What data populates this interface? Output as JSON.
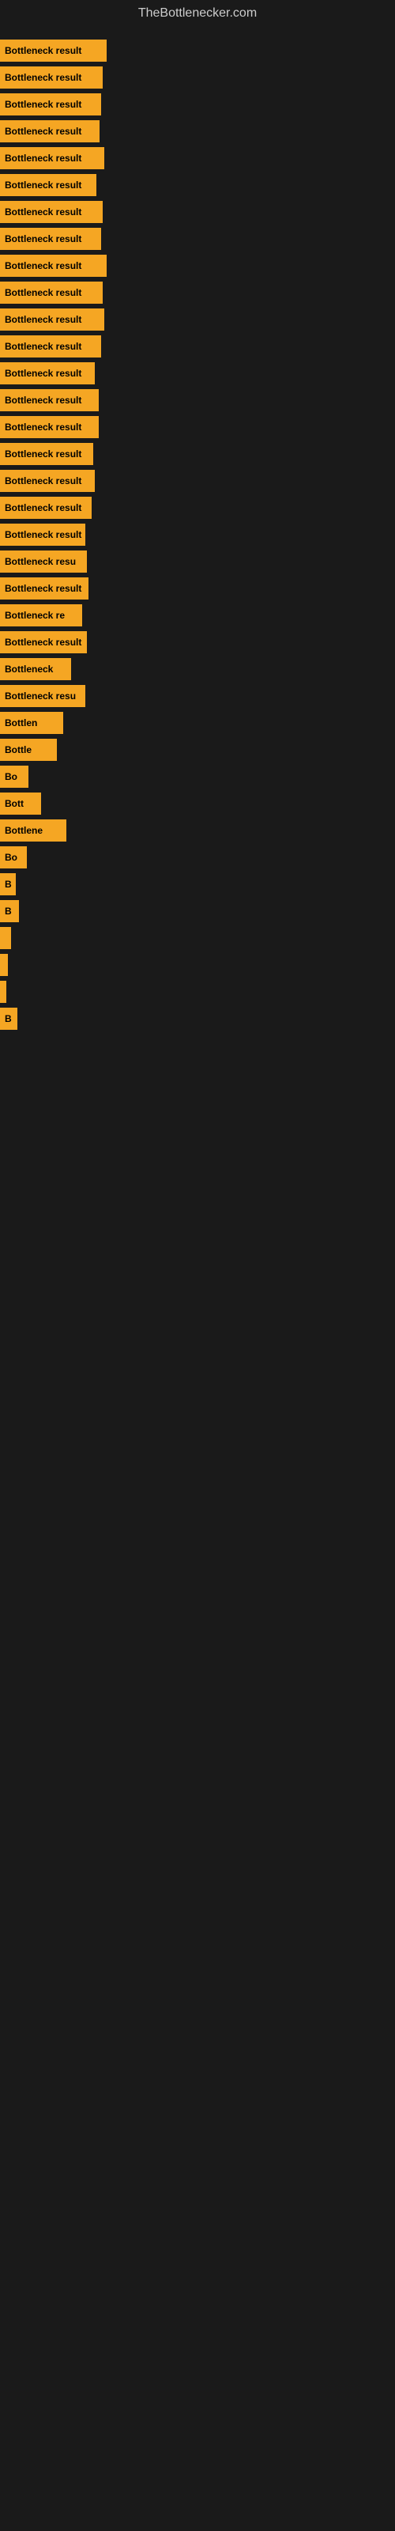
{
  "site": {
    "title": "TheBottlenecker.com"
  },
  "bars": [
    {
      "label": "Bottleneck result",
      "width": 135
    },
    {
      "label": "Bottleneck result",
      "width": 130
    },
    {
      "label": "Bottleneck result",
      "width": 128
    },
    {
      "label": "Bottleneck result",
      "width": 126
    },
    {
      "label": "Bottleneck result",
      "width": 132
    },
    {
      "label": "Bottleneck result",
      "width": 122
    },
    {
      "label": "Bottleneck result",
      "width": 130
    },
    {
      "label": "Bottleneck result",
      "width": 128
    },
    {
      "label": "Bottleneck result",
      "width": 135
    },
    {
      "label": "Bottleneck result",
      "width": 130
    },
    {
      "label": "Bottleneck result",
      "width": 132
    },
    {
      "label": "Bottleneck result",
      "width": 128
    },
    {
      "label": "Bottleneck result",
      "width": 120
    },
    {
      "label": "Bottleneck result",
      "width": 125
    },
    {
      "label": "Bottleneck result",
      "width": 125
    },
    {
      "label": "Bottleneck result",
      "width": 118
    },
    {
      "label": "Bottleneck result",
      "width": 120
    },
    {
      "label": "Bottleneck result",
      "width": 116
    },
    {
      "label": "Bottleneck result",
      "width": 108
    },
    {
      "label": "Bottleneck resu",
      "width": 110
    },
    {
      "label": "Bottleneck result",
      "width": 112
    },
    {
      "label": "Bottleneck re",
      "width": 104
    },
    {
      "label": "Bottleneck result",
      "width": 110
    },
    {
      "label": "Bottleneck",
      "width": 90
    },
    {
      "label": "Bottleneck resu",
      "width": 108
    },
    {
      "label": "Bottlen",
      "width": 80
    },
    {
      "label": "Bottle",
      "width": 72
    },
    {
      "label": "Bo",
      "width": 36
    },
    {
      "label": "Bott",
      "width": 52
    },
    {
      "label": "Bottlene",
      "width": 84
    },
    {
      "label": "Bo",
      "width": 34
    },
    {
      "label": "B",
      "width": 20
    },
    {
      "label": "B",
      "width": 24
    },
    {
      "label": "",
      "width": 14
    },
    {
      "label": "",
      "width": 10
    },
    {
      "label": "",
      "width": 8
    },
    {
      "label": "B",
      "width": 22
    }
  ]
}
